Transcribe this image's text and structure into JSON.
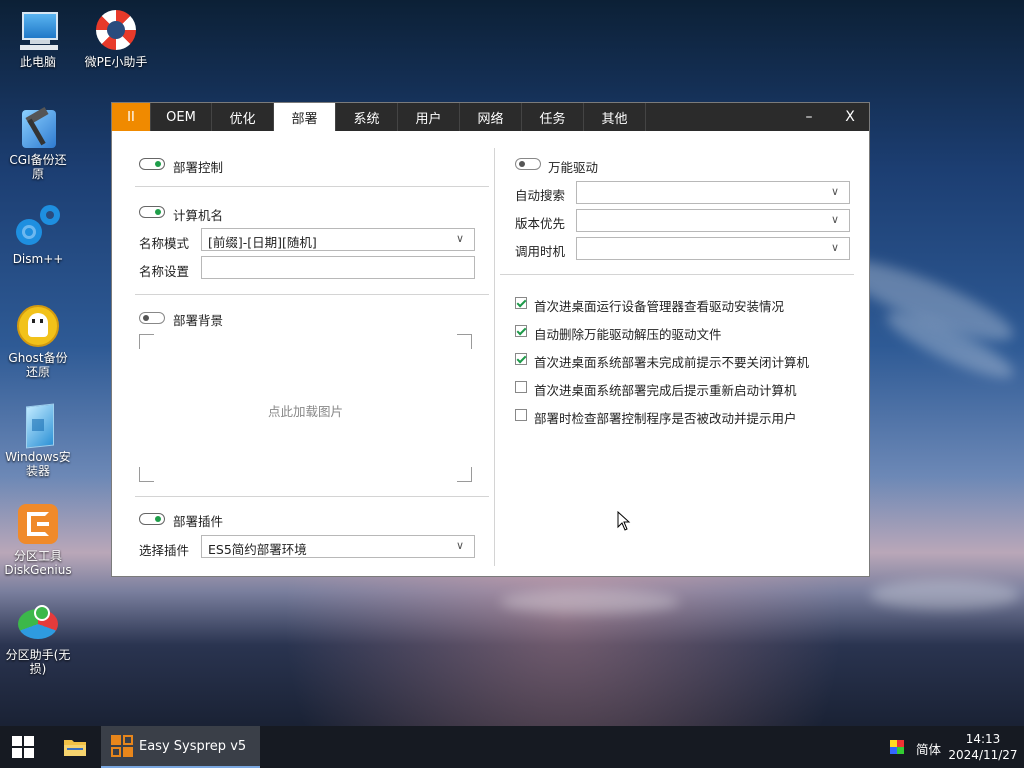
{
  "desktop": {
    "icons": [
      {
        "label": "此电脑"
      },
      {
        "label": "微PE小助手"
      },
      {
        "label": "CGI备份还原"
      },
      {
        "label": "Dism++"
      },
      {
        "label": "Ghost备份还原"
      },
      {
        "label": "Windows安装器"
      },
      {
        "label": "分区工具DiskGenius"
      },
      {
        "label": "分区助手(无损)"
      }
    ]
  },
  "window": {
    "tabs": [
      "II",
      "OEM",
      "优化",
      "部署",
      "系统",
      "用户",
      "网络",
      "任务",
      "其他"
    ],
    "active_tab": "部署",
    "minimize": "–",
    "close": "X",
    "left": {
      "deploy_control": {
        "label": "部署控制",
        "on": true
      },
      "computer_name": {
        "label": "计算机名",
        "on": true,
        "mode_label": "名称模式",
        "mode_value": "[前缀]-[日期][随机]",
        "setting_label": "名称设置",
        "setting_value": ""
      },
      "background": {
        "label": "部署背景",
        "on": false,
        "placeholder": "点此加载图片"
      },
      "plugin": {
        "label": "部署插件",
        "on": true,
        "select_label": "选择插件",
        "select_value": "ES5简约部署环境"
      }
    },
    "right": {
      "universal_driver": {
        "label": "万能驱动",
        "on": false
      },
      "auto_search": {
        "label": "自动搜索",
        "value": ""
      },
      "version_priority": {
        "label": "版本优先",
        "value": ""
      },
      "call_timing": {
        "label": "调用时机",
        "value": ""
      },
      "options": [
        {
          "label": "首次进桌面运行设备管理器查看驱动安装情况",
          "checked": true
        },
        {
          "label": "自动删除万能驱动解压的驱动文件",
          "checked": true
        },
        {
          "label": "首次进桌面系统部署未完成前提示不要关闭计算机",
          "checked": true
        },
        {
          "label": "首次进桌面系统部署完成后提示重新启动计算机",
          "checked": false
        },
        {
          "label": "部署时检查部署控制程序是否被改动并提示用户",
          "checked": false
        }
      ]
    }
  },
  "taskbar": {
    "app_title": "Easy Sysprep v5",
    "ime": "简体",
    "time": "14:13",
    "date": "2024/11/27"
  },
  "colors": {
    "accent": "#f08a00",
    "toggle_on": "#1f9e4a",
    "titlebar": "#2b2b2b",
    "taskbar": "#161a22"
  }
}
